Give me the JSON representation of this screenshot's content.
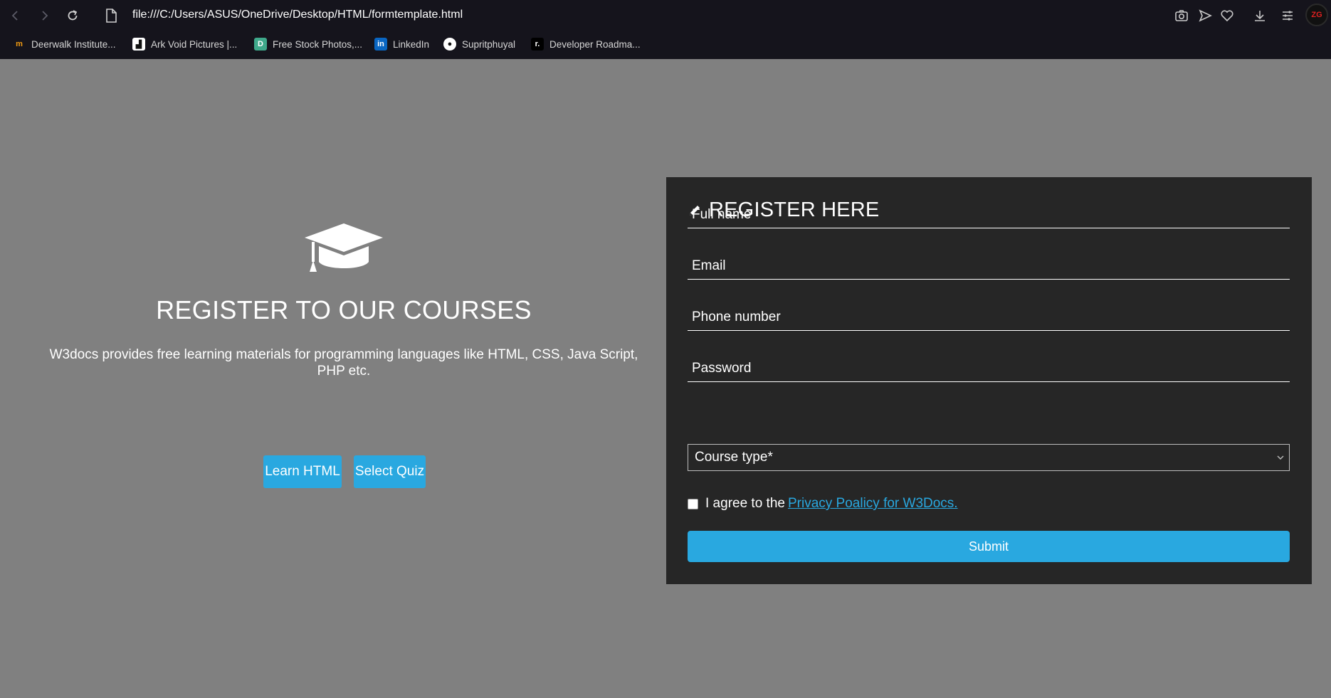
{
  "browser": {
    "url": "file:///C:/Users/ASUS/OneDrive/Desktop/HTML/formtemplate.html",
    "bookmarks": [
      {
        "label": "Deerwalk Institute...",
        "icon": "deerwalk-icon"
      },
      {
        "label": "Ark Void Pictures |...",
        "icon": "arkvoid-icon"
      },
      {
        "label": "Free Stock Photos,...",
        "icon": "stock-photos-icon"
      },
      {
        "label": "LinkedIn",
        "icon": "linkedin-icon"
      },
      {
        "label": "Supritphuyal",
        "icon": "github-icon"
      },
      {
        "label": "Developer Roadma...",
        "icon": "roadmap-icon"
      }
    ],
    "avatar_text": "ZG"
  },
  "left": {
    "title": "REGISTER TO OUR COURSES",
    "description": "W3docs provides free learning materials for programming languages like HTML, CSS, Java Script, PHP etc.",
    "btn_learn": "Learn HTML",
    "btn_quiz": "Select Quiz"
  },
  "form": {
    "title": "REGISTER HERE",
    "fields": {
      "fullname": "Full name",
      "email": "Email",
      "phone": "Phone number",
      "password": "Password"
    },
    "course_select": "Course type*",
    "agree_text": "I agree to the",
    "agree_link": "Privacy Poalicy for W3Docs.",
    "submit": "Submit"
  },
  "colors": {
    "accent": "#29a8e0",
    "page_bg": "#808080",
    "panel_bg": "#262626",
    "chrome_bg": "#15141c"
  }
}
